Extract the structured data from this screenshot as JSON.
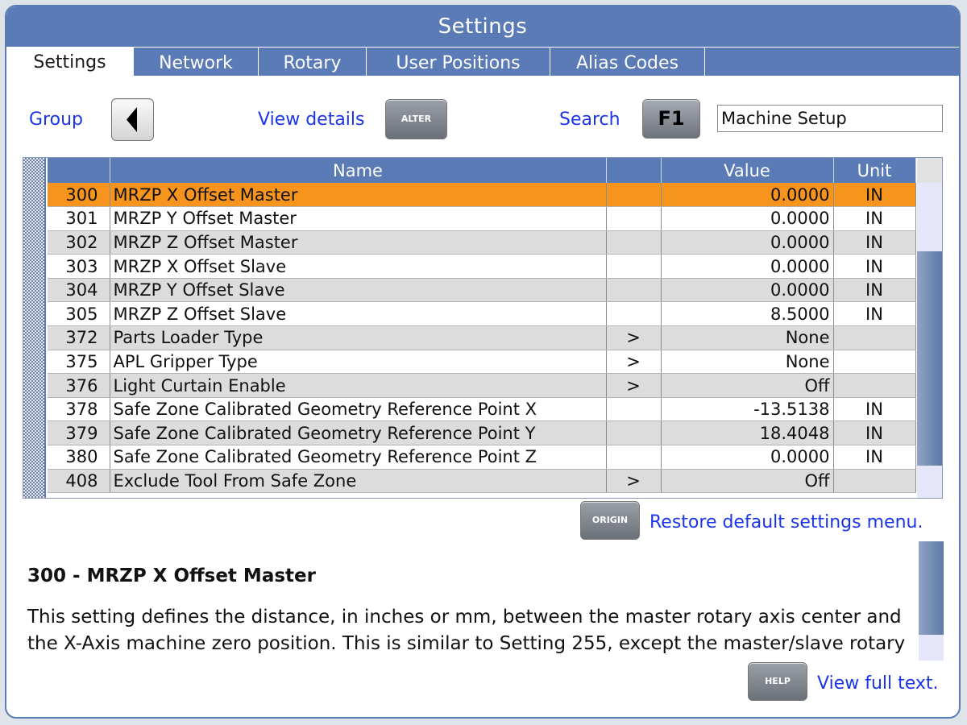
{
  "window": {
    "title": "Settings"
  },
  "tabs": [
    {
      "label": "Settings"
    },
    {
      "label": "Network"
    },
    {
      "label": "Rotary"
    },
    {
      "label": "User Positions"
    },
    {
      "label": "Alias Codes"
    }
  ],
  "toolbar": {
    "group_label": "Group",
    "view_details_label": "View details",
    "alter_key": "ALTER",
    "search_label": "Search",
    "f1_key": "F1",
    "search_value": "Machine Setup"
  },
  "table": {
    "columns": [
      "",
      "Name",
      "",
      "Value",
      "Unit"
    ],
    "rows": [
      {
        "num": "300",
        "name": "MRZP X Offset Master",
        "arrow": "",
        "value": "0.0000",
        "unit": "IN",
        "selected": true
      },
      {
        "num": "301",
        "name": "MRZP Y Offset Master",
        "arrow": "",
        "value": "0.0000",
        "unit": "IN"
      },
      {
        "num": "302",
        "name": "MRZP Z Offset Master",
        "arrow": "",
        "value": "0.0000",
        "unit": "IN"
      },
      {
        "num": "303",
        "name": "MRZP X Offset Slave",
        "arrow": "",
        "value": "0.0000",
        "unit": "IN"
      },
      {
        "num": "304",
        "name": "MRZP Y Offset Slave",
        "arrow": "",
        "value": "0.0000",
        "unit": "IN"
      },
      {
        "num": "305",
        "name": "MRZP Z Offset Slave",
        "arrow": "",
        "value": "8.5000",
        "unit": "IN"
      },
      {
        "num": "372",
        "name": "Parts Loader Type",
        "arrow": ">",
        "value": "None",
        "unit": ""
      },
      {
        "num": "375",
        "name": "APL Gripper Type",
        "arrow": ">",
        "value": "None",
        "unit": ""
      },
      {
        "num": "376",
        "name": "Light Curtain Enable",
        "arrow": ">",
        "value": "Off",
        "unit": ""
      },
      {
        "num": "378",
        "name": "Safe Zone Calibrated Geometry Reference Point X",
        "arrow": "",
        "value": "-13.5138",
        "unit": "IN"
      },
      {
        "num": "379",
        "name": "Safe Zone Calibrated Geometry Reference Point Y",
        "arrow": "",
        "value": "18.4048",
        "unit": "IN"
      },
      {
        "num": "380",
        "name": "Safe Zone Calibrated Geometry Reference Point Z",
        "arrow": "",
        "value": "0.0000",
        "unit": "IN"
      },
      {
        "num": "408",
        "name": "Exclude Tool From Safe Zone",
        "arrow": ">",
        "value": "Off",
        "unit": ""
      }
    ]
  },
  "restore": {
    "origin_key": "ORIGIN",
    "label": "Restore default settings menu."
  },
  "detail": {
    "title": "300 - MRZP X Offset Master",
    "body": "This setting defines the distance, in inches or mm, between the master rotary axis center and the X-Axis machine zero position. This is similar to Setting 255, except the master/slave rotary table is used."
  },
  "help": {
    "help_key": "HELP",
    "label": "View full text."
  },
  "colors": {
    "accent": "#5b7bb7",
    "selected_row": "#f7941d",
    "link": "#1b35e8"
  }
}
